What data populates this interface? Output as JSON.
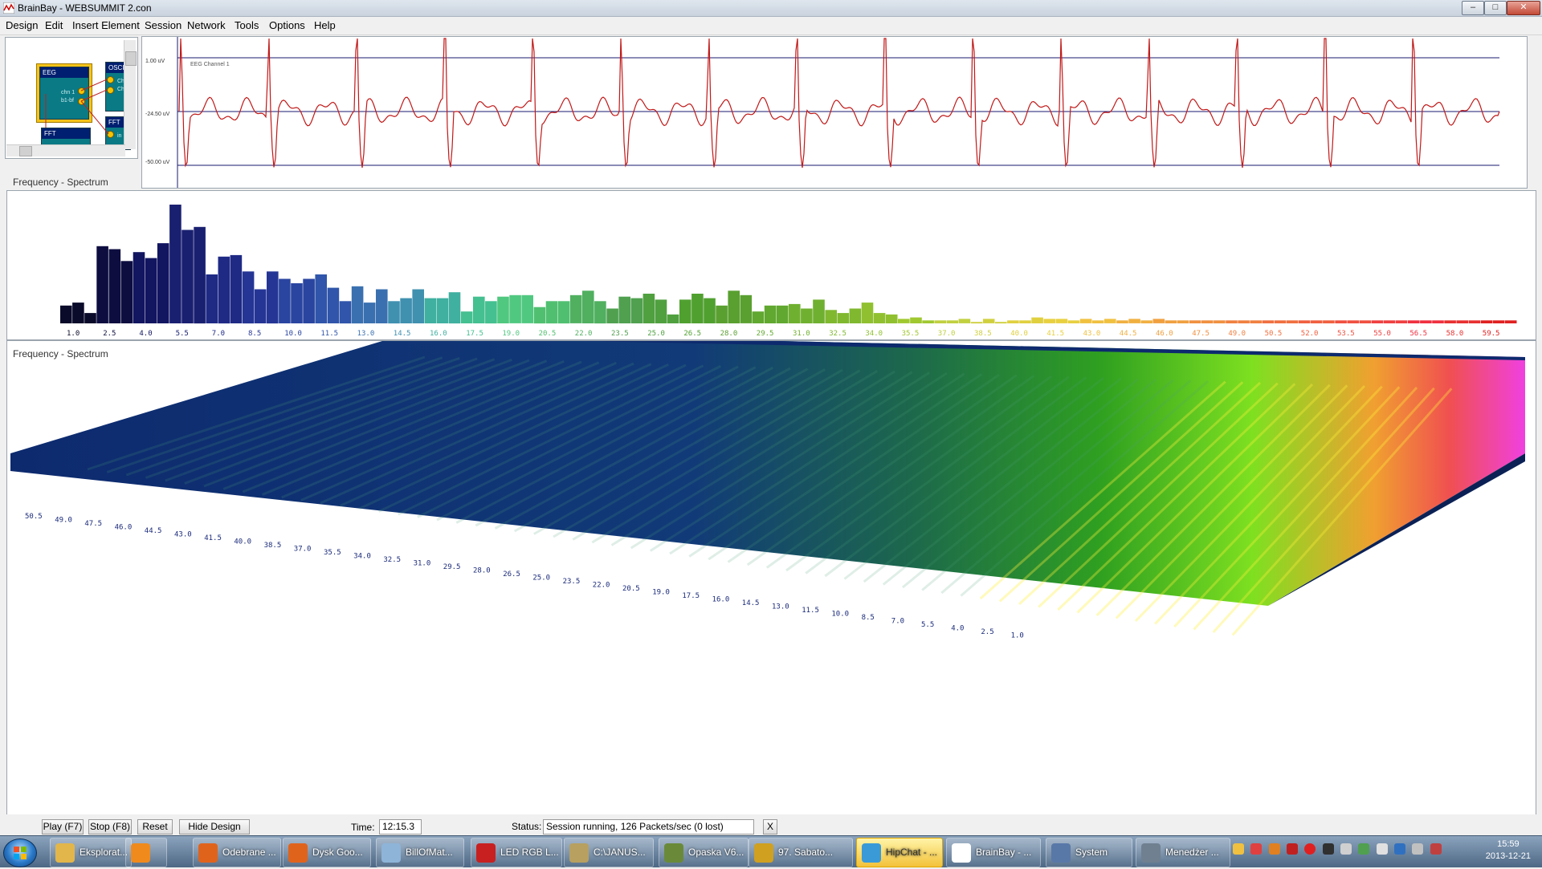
{
  "window": {
    "title": "BrainBay - WEBSUMMIT 2.con",
    "minimize": "–",
    "maximize": "□",
    "close": "✕"
  },
  "menu": [
    "Design",
    "Edit",
    "Insert Element",
    "Session",
    "Network",
    "Tools",
    "Options",
    "Help"
  ],
  "design": {
    "elements": [
      {
        "name": "EEG",
        "rows": [
          "chn 1",
          "b1-bf"
        ]
      },
      {
        "name": "OSCI",
        "rows": [
          "Chn",
          "Chn"
        ]
      },
      {
        "name": "FFT",
        "rows": [
          "in"
        ]
      },
      {
        "name": "FFT",
        "rows": []
      }
    ]
  },
  "oscilloscope": {
    "channel": "EEG Channel 1",
    "y_labels": [
      "1.00 uV",
      "-24.50 uV",
      "-50.00 uV"
    ]
  },
  "spectrum_bar": {
    "title": "Frequency - Spectrum",
    "x_labels": [
      "1.0",
      "2.5",
      "4.0",
      "5.5",
      "7.0",
      "8.5",
      "10.0",
      "11.5",
      "13.0",
      "14.5",
      "16.0",
      "17.5",
      "19.0",
      "20.5",
      "22.0",
      "23.5",
      "25.0",
      "26.5",
      "28.0",
      "29.5",
      "31.0",
      "32.5",
      "34.0",
      "35.5",
      "37.0",
      "38.5",
      "40.0",
      "41.5",
      "43.0",
      "44.5",
      "46.0",
      "47.5",
      "49.0",
      "50.5",
      "52.0",
      "53.5",
      "55.0",
      "56.5",
      "58.0",
      "59.5"
    ],
    "label_colors": [
      "#0a0a2a",
      "#0d0d40",
      "#121560",
      "#1a2070",
      "#1f2a85",
      "#253595",
      "#2a45a0",
      "#3055aa",
      "#3a70b0",
      "#4090b0",
      "#40b0a0",
      "#45c090",
      "#50c880",
      "#50c070",
      "#50b060",
      "#50a050",
      "#50a040",
      "#50a030",
      "#5aa030",
      "#60a830",
      "#70b030",
      "#80b830",
      "#90c030",
      "#a0c830",
      "#c0d040",
      "#d0d040",
      "#e0d040",
      "#e8d040",
      "#f0c040",
      "#f0b040",
      "#f0a040",
      "#f09040",
      "#f08040",
      "#f07040",
      "#f06040",
      "#f05040",
      "#f04040",
      "#f03040",
      "#e83030",
      "#e02020"
    ],
    "bars": [
      12,
      14,
      7,
      52,
      50,
      42,
      48,
      44,
      54,
      80,
      63,
      65,
      33,
      45,
      46,
      35,
      23,
      35,
      30,
      27,
      30,
      33,
      24,
      15,
      25,
      14,
      23,
      15,
      17,
      23,
      17,
      17,
      21,
      8,
      18,
      15,
      18,
      19,
      19,
      11,
      15,
      15,
      19,
      22,
      15,
      10,
      18,
      17,
      20,
      16,
      6,
      16,
      20,
      17,
      12,
      22,
      19,
      8,
      12,
      12,
      13,
      10,
      16,
      9,
      7,
      10,
      14,
      7,
      6,
      3,
      4,
      2,
      2,
      2,
      3,
      1,
      3,
      1,
      2,
      2,
      4,
      3,
      3,
      2,
      3,
      2,
      3,
      2,
      3,
      2,
      3,
      2,
      2,
      2,
      2,
      2,
      2,
      2,
      2,
      2,
      2,
      2,
      2,
      2,
      2,
      2,
      2,
      2,
      2,
      2,
      2,
      2,
      2,
      2,
      2,
      2,
      2,
      2,
      2,
      2
    ]
  },
  "spectrum_3d": {
    "title": "Frequency - Spectrum",
    "axis_labels": [
      "50.5",
      "49.0",
      "47.5",
      "46.0",
      "44.5",
      "43.0",
      "41.5",
      "40.0",
      "38.5",
      "37.0",
      "35.5",
      "34.0",
      "32.5",
      "31.0",
      "29.5",
      "28.0",
      "26.5",
      "25.0",
      "23.5",
      "22.0",
      "20.5",
      "19.0",
      "17.5",
      "16.0",
      "14.5",
      "13.0",
      "11.5",
      "10.0",
      "8.5",
      "7.0",
      "5.5",
      "4.0",
      "2.5",
      "1.0"
    ]
  },
  "controls": {
    "play": "Play (F7)",
    "stop": "Stop (F8)",
    "reset": "Reset",
    "hide": "Hide Design",
    "time_label": "Time:",
    "time_value": "12:15.3",
    "status_label": "Status:",
    "status_value": "Session running,  126 Packets/sec (0 lost)",
    "close": "X"
  },
  "taskbar": {
    "items": [
      {
        "label": "Eksplorat...",
        "color": "#e2b64a"
      },
      {
        "label": "",
        "color": "#f08a1c"
      },
      {
        "label": "Odebrane ...",
        "color": "#e0631c"
      },
      {
        "label": "Dysk Goo...",
        "color": "#e0631c"
      },
      {
        "label": "BillOfMat...",
        "color": "#8eb4d8"
      },
      {
        "label": "LED RGB L...",
        "color": "#c82020"
      },
      {
        "label": "C:\\JANUS...",
        "color": "#b8a060"
      },
      {
        "label": "Opaska V6...",
        "color": "#6a8a3a"
      },
      {
        "label": "97. Sabato...",
        "color": "#d0a020"
      },
      {
        "label": "HipChat - ...",
        "color": "#3a9ad8"
      },
      {
        "label": "BrainBay - ...",
        "color": "#ffffff"
      },
      {
        "label": "System",
        "color": "#5878a8"
      },
      {
        "label": "Menedżer ...",
        "color": "#708090"
      }
    ],
    "clock_time": "15:59",
    "clock_date": "2013-12-21"
  }
}
